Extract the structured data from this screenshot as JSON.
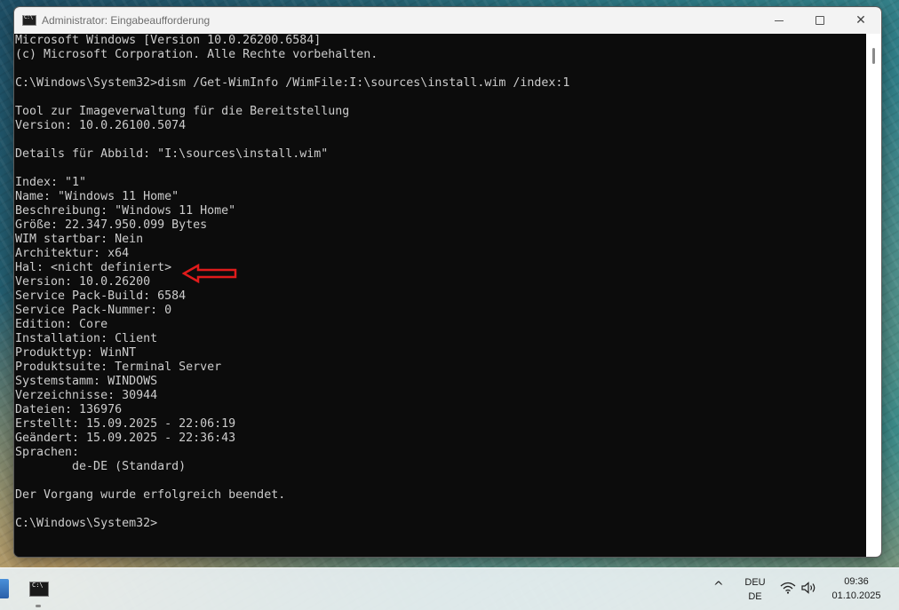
{
  "window": {
    "title": "Administrator: Eingabeaufforderung",
    "close_glyph": "✕"
  },
  "console": {
    "lines": [
      "Microsoft Windows [Version 10.0.26200.6584]",
      "(c) Microsoft Corporation. Alle Rechte vorbehalten.",
      "",
      "C:\\Windows\\System32>dism /Get-WimInfo /WimFile:I:\\sources\\install.wim /index:1",
      "",
      "Tool zur Imageverwaltung für die Bereitstellung",
      "Version: 10.0.26100.5074",
      "",
      "Details für Abbild: \"I:\\sources\\install.wim\"",
      "",
      "Index: \"1\"",
      "Name: \"Windows 11 Home\"",
      "Beschreibung: \"Windows 11 Home\"",
      "Größe: 22.347.950.099 Bytes",
      "WIM startbar: Nein",
      "Architektur: x64",
      "Hal: <nicht definiert>",
      "Version: 10.0.26200",
      "Service Pack-Build: 6584",
      "Service Pack-Nummer: 0",
      "Edition: Core",
      "Installation: Client",
      "Produkttyp: WinNT",
      "Produktsuite: Terminal Server",
      "Systemstamm: WINDOWS",
      "Verzeichnisse: 30944",
      "Dateien: 136976",
      "Erstellt: 15.09.2025 - 22:06:19",
      "Geändert: 15.09.2025 - 22:36:43",
      "Sprachen:",
      "        de-DE (Standard)",
      "",
      "Der Vorgang wurde erfolgreich beendet.",
      "",
      "C:\\Windows\\System32>"
    ],
    "text_color": "#cccccc",
    "background": "#0c0c0c"
  },
  "annotation": {
    "arrow_color": "#e01b1b"
  },
  "taskbar": {
    "tray_chevron": "^",
    "language_line1": "DEU",
    "language_line2": "DE",
    "time": "09:36",
    "date": "01.10.2025"
  }
}
